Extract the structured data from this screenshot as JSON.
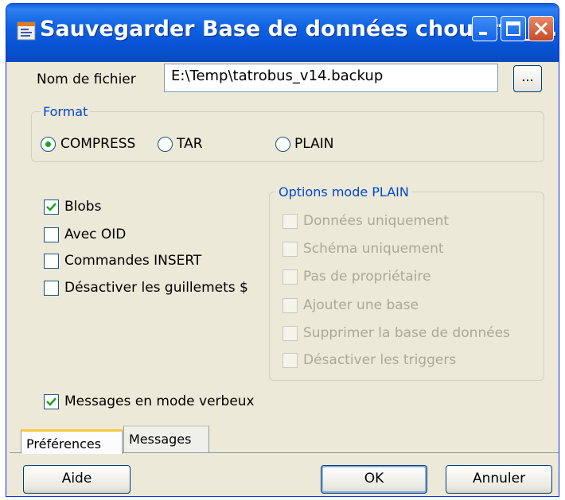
{
  "window": {
    "title": "Sauvegarder Base de données chouette_p...",
    "accent_color": "#0a5fe0"
  },
  "filename": {
    "label": "Nom de fichier",
    "value": "E:\\Temp\\tatrobus_v14.backup",
    "browse_label": "..."
  },
  "format": {
    "legend": "Format",
    "options": [
      {
        "label": "COMPRESS",
        "selected": true
      },
      {
        "label": "TAR",
        "selected": false
      },
      {
        "label": "PLAIN",
        "selected": false
      }
    ]
  },
  "options": {
    "blobs": {
      "label": "Blobs",
      "checked": true
    },
    "oid": {
      "label": "Avec OID",
      "checked": false
    },
    "insert": {
      "label": "Commandes INSERT",
      "checked": false
    },
    "dollar": {
      "label": "Désactiver les guillemets $",
      "checked": false
    }
  },
  "plain_options": {
    "legend": "Options mode PLAIN",
    "items": [
      {
        "label": "Données uniquement"
      },
      {
        "label": "Schéma uniquement"
      },
      {
        "label": "Pas de propriétaire"
      },
      {
        "label": "Ajouter une base"
      },
      {
        "label": "Supprimer la base de données"
      },
      {
        "label": "Désactiver les triggers"
      }
    ]
  },
  "verbose": {
    "label": "Messages en mode verbeux",
    "checked": true
  },
  "tabs": [
    {
      "label": "Préférences",
      "active": true
    },
    {
      "label": "Messages",
      "active": false
    }
  ],
  "buttons": {
    "help": "Aide",
    "ok": "OK",
    "cancel": "Annuler"
  }
}
